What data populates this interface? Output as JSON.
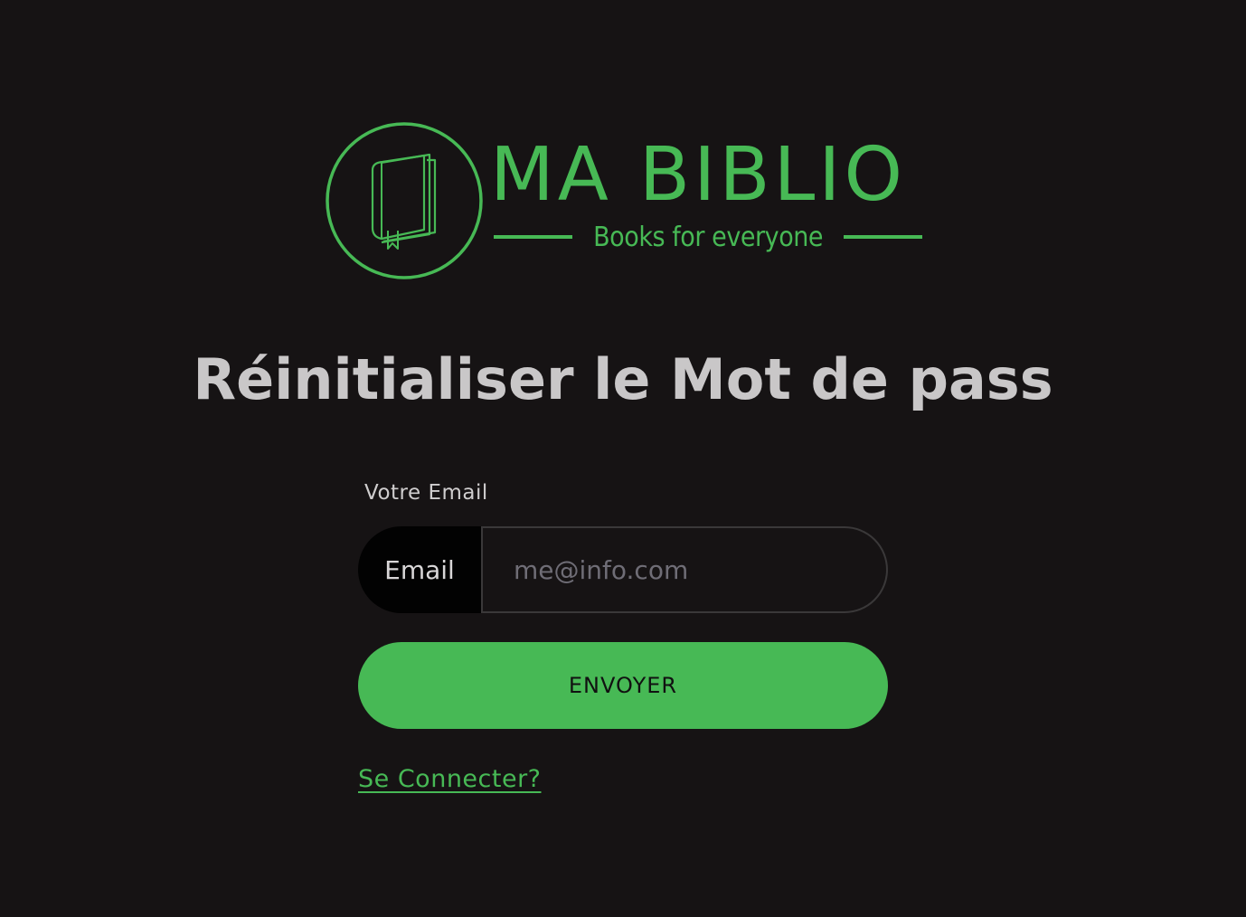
{
  "brand": {
    "title": "MA BIBLIO",
    "tagline": "Books for everyone",
    "logo_icon": "book-icon"
  },
  "page": {
    "heading": "Réinitialiser le Mot de pass"
  },
  "form": {
    "email_label": "Votre Email",
    "email_prefix": "Email",
    "email_value": "",
    "email_placeholder": "me@info.com",
    "submit_label": "ENVOYER",
    "login_link": "Se Connecter? "
  },
  "colors": {
    "background": "#161314",
    "accent": "#47b955",
    "heading_text": "#c9c7c8",
    "input_prefix_bg": "#020202",
    "placeholder_text": "#6f6d76"
  }
}
